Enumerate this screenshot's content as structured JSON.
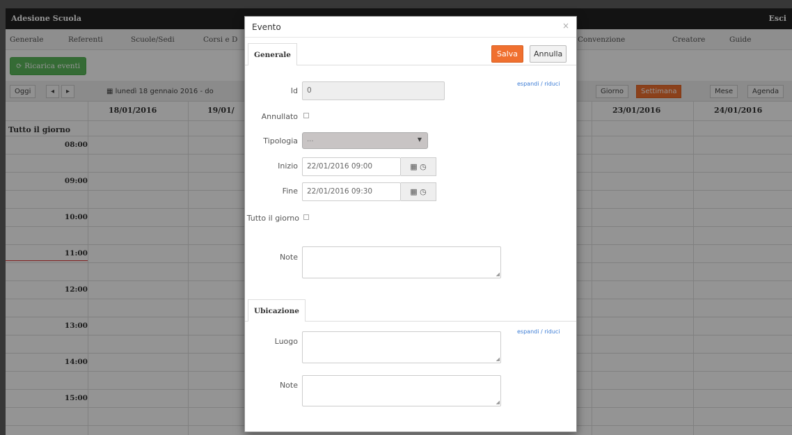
{
  "app": {
    "title": "Adesione Scuola",
    "exit_label": "Esci",
    "menu": [
      "Generale",
      "Referenti",
      "Scuole/Sedi",
      "Corsi e D",
      "Convenzione",
      "Creatore",
      "Guide"
    ],
    "reload_label": "Ricarica eventi",
    "calendar": {
      "today_label": "Oggi",
      "prev_label": "◂",
      "next_label": "▸",
      "date_range": "lunedì 18 gennaio 2016 - do",
      "views": [
        "Giorno",
        "Settimana",
        "Mese",
        "Agenda"
      ],
      "active_view": "Settimana",
      "days": [
        "18/01/2016",
        "19/01/",
        "23/01/2016",
        "24/01/2016"
      ],
      "all_day_label": "Tutto il giorno",
      "times": [
        "08:00",
        "09:00",
        "10:00",
        "11:00",
        "12:00",
        "13:00",
        "14:00",
        "15:00"
      ]
    }
  },
  "modal": {
    "title": "Evento",
    "close": "×",
    "tab_general": "Generale",
    "save_label": "Salva",
    "cancel_label": "Annulla",
    "expand_toggle": "espandi / riduci",
    "fields": {
      "id_label": "Id",
      "id_value": "0",
      "annullato_label": "Annullato",
      "tipologia_label": "Tipologia",
      "tipologia_value": "...",
      "inizio_label": "Inizio",
      "inizio_value": "22/01/2016 09:00",
      "fine_label": "Fine",
      "fine_value": "22/01/2016 09:30",
      "tutto_giorno_label": "Tutto il giorno",
      "note_label": "Note"
    },
    "tab_location": "Ubicazione",
    "location_fields": {
      "luogo_label": "Luogo",
      "note_label": "Note"
    },
    "icons": {
      "calendar": "▦",
      "clock": "◷"
    }
  }
}
